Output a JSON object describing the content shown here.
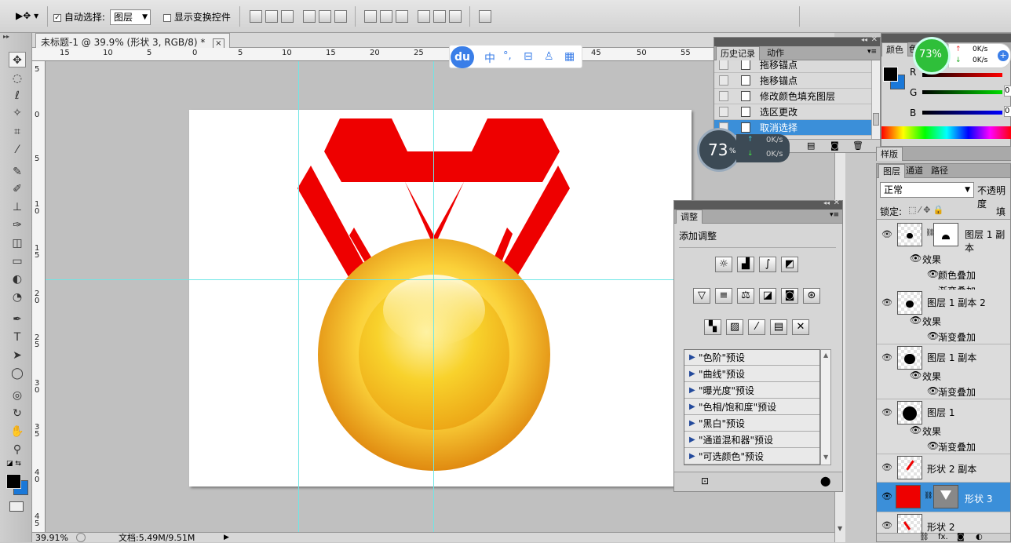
{
  "options": {
    "auto_select_label": "自动选择:",
    "auto_select_value": "图层",
    "show_transform_label": "显示变换控件"
  },
  "document": {
    "tab_title": "未标题-1 @ 39.9% (形状 3, RGB/8) *",
    "close": "×"
  },
  "ruler_h": [
    "15",
    "10",
    "5",
    "0",
    "5",
    "10",
    "15",
    "20",
    "25",
    "45",
    "50",
    "55"
  ],
  "ruler_v": [
    "5",
    "0",
    "5",
    "1\n0",
    "1\n5",
    "2\n0",
    "2\n5",
    "3\n0",
    "3\n5",
    "4\n0",
    "4\n5"
  ],
  "ime_toolbar": {
    "logo": "du",
    "items": [
      "中",
      "°,",
      "⊟",
      "♙",
      "▦"
    ]
  },
  "status": {
    "zoom": "39.91%",
    "doc_info": "文档:5.49M/9.51M"
  },
  "history_panel": {
    "tabs": [
      "历史记录",
      "动作"
    ],
    "items": [
      "拖移锚点",
      "拖移锚点",
      "修改颜色填充图层",
      "选区更改",
      "取消选择"
    ],
    "selected_index": 4
  },
  "speed_widget_small": {
    "percent": "73",
    "unit": "%",
    "up": "0K/s",
    "down": "0K/s"
  },
  "speed_widget_big": {
    "percent": "73%",
    "up": "0K/s",
    "down": "0K/s"
  },
  "color_panel": {
    "tabs": [
      "颜色",
      "色"
    ],
    "channels": [
      {
        "label": "R",
        "value": "0"
      },
      {
        "label": "G",
        "value": "0"
      },
      {
        "label": "B",
        "value": "0"
      }
    ],
    "fg_color": "#000000",
    "bg_color": "#1a78d8"
  },
  "swatches_tab": "样版",
  "adjustments_panel": {
    "tab": "调整",
    "title": "添加调整",
    "presets": [
      "\"色阶\"预设",
      "\"曲线\"预设",
      "\"曝光度\"预设",
      "\"色相/饱和度\"预设",
      "\"黑白\"预设",
      "\"通道混和器\"预设",
      "\"可选颜色\"预设"
    ]
  },
  "layers_panel": {
    "tabs": [
      "图层",
      "通道",
      "路径"
    ],
    "blend_mode": "正常",
    "opacity_label": "不透明度",
    "lock_label": "锁定:",
    "fill_label": "填充",
    "layers": [
      {
        "name": "图层 1 副本",
        "effects_label": "效果",
        "effects": [
          "颜色叠加",
          "渐变叠加"
        ]
      },
      {
        "name": "图层 1 副本 2",
        "effects_label": "效果",
        "effects": [
          "渐变叠加"
        ]
      },
      {
        "name": "图层 1 副本",
        "effects_label": "效果",
        "effects": [
          "渐变叠加"
        ]
      },
      {
        "name": "图层 1",
        "effects_label": "效果",
        "effects": [
          "渐变叠加"
        ]
      },
      {
        "name": "形状 2 副本"
      },
      {
        "name": "形状 3"
      },
      {
        "name": "形状 2"
      }
    ]
  },
  "colors": {
    "selection": "#3b8fd9",
    "medal_red": "#ee0000",
    "gold": "#f2b31c",
    "guide": "#6fe6e6"
  }
}
